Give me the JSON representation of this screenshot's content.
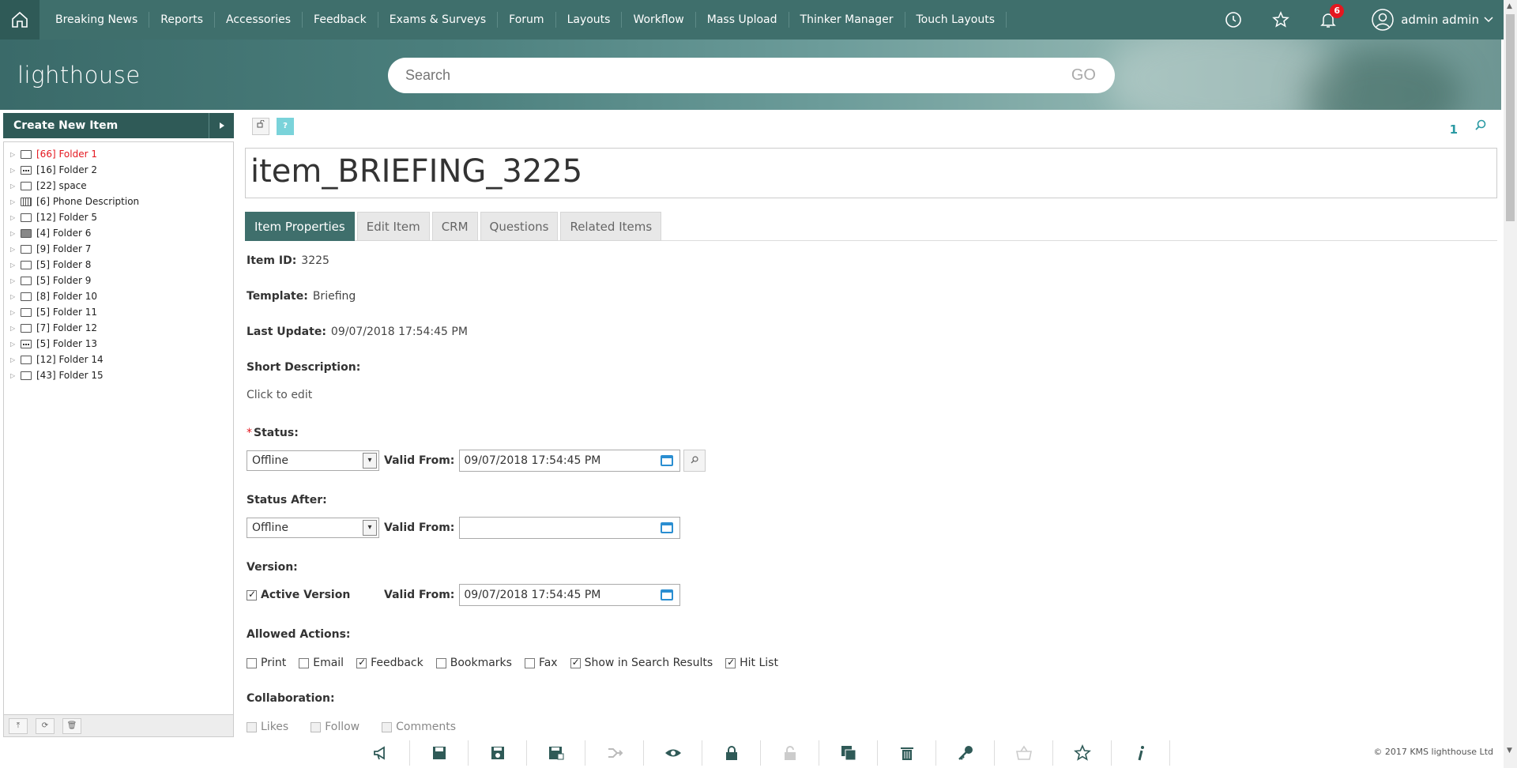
{
  "nav": {
    "items": [
      "Breaking News",
      "Reports",
      "Accessories",
      "Feedback",
      "Exams & Surveys",
      "Forum",
      "Layouts",
      "Workflow",
      "Mass Upload",
      "Thinker Manager",
      "Touch Layouts"
    ],
    "notification_count": "6",
    "user_name": "admin admin"
  },
  "banner": {
    "logo": "lighthouse",
    "search_placeholder": "Search",
    "go_label": "GO"
  },
  "sidebar": {
    "create_label": "Create New Item",
    "folders": [
      {
        "label": "[66] Folder 1",
        "icon": "folder",
        "highlight": true
      },
      {
        "label": "[16] Folder 2",
        "icon": "folder-dots"
      },
      {
        "label": "[22] space",
        "icon": "folder"
      },
      {
        "label": "[6] Phone Description",
        "icon": "folder-grid"
      },
      {
        "label": "[12] Folder 5",
        "icon": "folder"
      },
      {
        "label": "[4] Folder 6",
        "icon": "folder-filled"
      },
      {
        "label": "[9] Folder 7",
        "icon": "folder"
      },
      {
        "label": "[5] Folder 8",
        "icon": "folder"
      },
      {
        "label": "[5] Folder 9",
        "icon": "folder"
      },
      {
        "label": "[8] Folder 10",
        "icon": "folder"
      },
      {
        "label": "[5] Folder 11",
        "icon": "folder"
      },
      {
        "label": "[7] Folder 12",
        "icon": "folder"
      },
      {
        "label": "[5] Folder 13",
        "icon": "folder-dots"
      },
      {
        "label": "[12] Folder 14",
        "icon": "folder"
      },
      {
        "label": "[43] Folder 15",
        "icon": "folder"
      }
    ]
  },
  "main": {
    "help_label": "?",
    "counter": "1",
    "item_title": "item_BRIEFING_3225",
    "tabs": [
      "Item Properties",
      "Edit Item",
      "CRM",
      "Questions",
      "Related Items"
    ],
    "item_id_label": "Item ID:",
    "item_id": "3225",
    "template_label": "Template:",
    "template": "Briefing",
    "last_update_label": "Last Update:",
    "last_update": "09/07/2018 17:54:45 PM",
    "short_desc_label": "Short Description:",
    "short_desc": "Click to edit",
    "status_label": "Status:",
    "status_value": "Offline",
    "valid_from_label": "Valid From:",
    "status_valid_from": "09/07/2018 17:54:45 PM",
    "status_after_label": "Status After:",
    "status_after_value": "Offline",
    "status_after_valid_from": "",
    "version_label": "Version:",
    "active_version_label": "Active Version",
    "version_valid_from": "09/07/2018 17:54:45 PM",
    "allowed_actions_label": "Allowed Actions:",
    "allowed_actions": [
      {
        "label": "Print",
        "checked": false
      },
      {
        "label": "Email",
        "checked": false
      },
      {
        "label": "Feedback",
        "checked": true
      },
      {
        "label": "Bookmarks",
        "checked": false
      },
      {
        "label": "Fax",
        "checked": false
      },
      {
        "label": "Show in Search Results",
        "checked": true
      },
      {
        "label": "Hit List",
        "checked": true
      }
    ],
    "collaboration_label": "Collaboration:",
    "collaboration": [
      {
        "label": "Likes",
        "checked": false
      },
      {
        "label": "Follow",
        "checked": false
      },
      {
        "label": "Comments",
        "checked": false
      }
    ]
  },
  "toolbar": {
    "icons": [
      "megaphone-icon",
      "save-icon",
      "save-preview-icon",
      "save-as-icon",
      "move-icon",
      "preview-icon",
      "lock-icon",
      "unlock-icon",
      "copy-icon",
      "delete-icon",
      "key-icon",
      "basket-icon",
      "star-icon",
      "info-icon"
    ]
  },
  "footer": {
    "copyright": "© 2017 KMS lighthouse Ltd"
  },
  "colors": {
    "primary": "#3f6f6c",
    "dark": "#2f5a57",
    "accent": "#2a9aa3",
    "badge": "#e4171f"
  }
}
